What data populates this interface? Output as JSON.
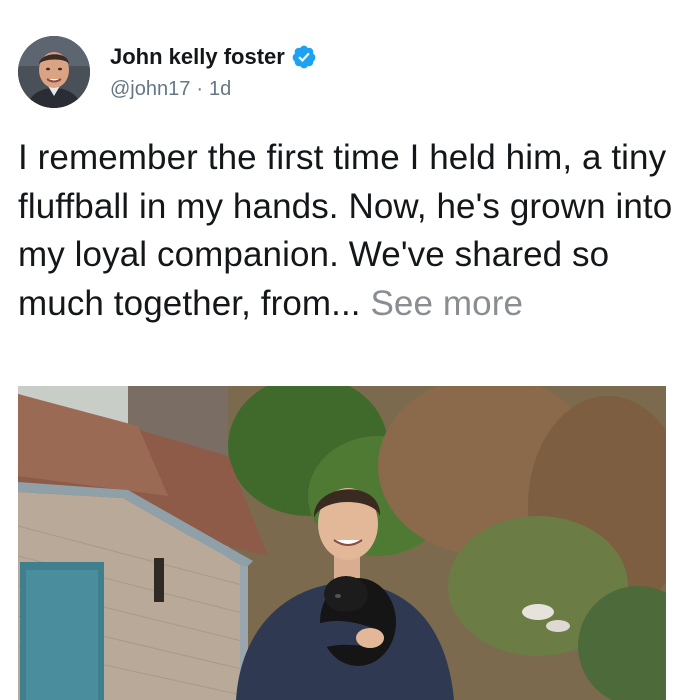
{
  "tweet": {
    "author": {
      "display_name": "John kelly foster",
      "handle": "@john17",
      "verified_icon": "verified-badge-icon",
      "verified_color": "#1da1f2"
    },
    "time_separator": "·",
    "timestamp": "1d",
    "text": "I remember the first time I held him, a tiny fluffball in my hands. Now, he's grown into my loyal companion. We've shared so much together, from...",
    "see_more_label": "See more",
    "media": {
      "kind": "photo"
    }
  }
}
